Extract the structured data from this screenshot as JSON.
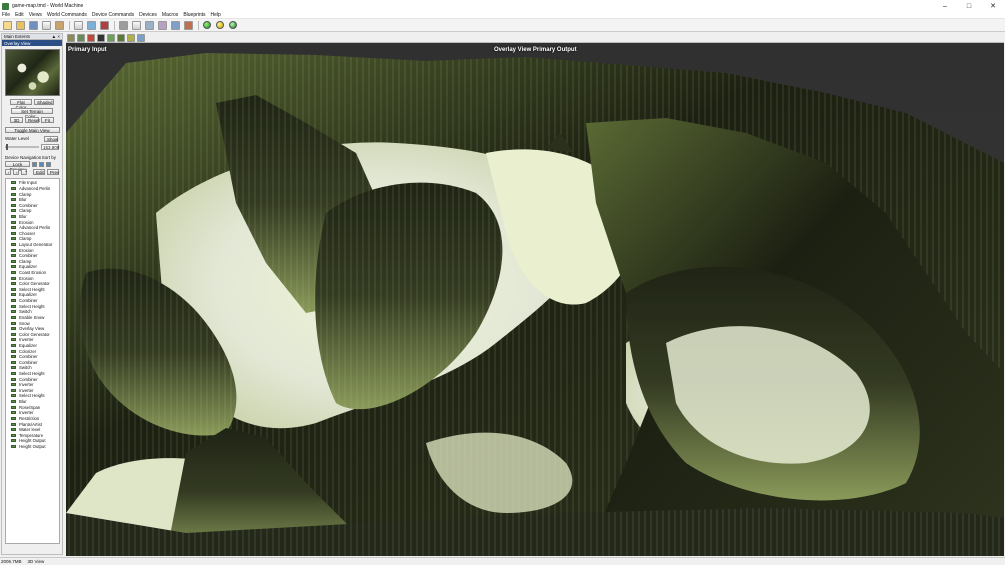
{
  "window": {
    "title": "game-map.tmd - World Machine"
  },
  "menu": [
    "File",
    "Edit",
    "Views",
    "World Commands",
    "Device Commands",
    "Devices",
    "Macros",
    "Blueprints",
    "Help"
  ],
  "toolbar_icons": [
    "new-file-icon",
    "open-folder-icon",
    "save-icon",
    "properties-icon",
    "world-settings-icon",
    "undo-icon",
    "chart-icon",
    "build-icon",
    "grid-icon",
    "layout-icon",
    "render-icon",
    "device-icon",
    "image-icon",
    "export-icon",
    "ball-green-icon",
    "ball-yellow-icon",
    "ball-globe-icon"
  ],
  "panel": {
    "title": "Main Extents",
    "overlay_view_label": "Overlay View",
    "flat_color": "Flat Color",
    "shaded": "Shaded",
    "set_terrain_color": "Set Terrain Color...",
    "btn_3d": "3D",
    "reset": "Reset",
    "fit": "Fit",
    "toggle_main_view": "Toggle Main View",
    "water_level": "Water Level",
    "show": "Show",
    "water_value": "153.809",
    "device_navigation": "Device Navigation",
    "sort_by": "Sort by",
    "lock_preview": "Lock Preview",
    "edit": "Edit",
    "prev": "Prev"
  },
  "devices": [
    "File Input",
    "Advanced Perlin",
    "Clamp",
    "Blur",
    "Combiner",
    "Clamp",
    "Blur",
    "Erosion",
    "Advanced Perlin",
    "Chooser",
    "Clamp",
    "Layout Generator",
    "Erosion",
    "Combiner",
    "Clamp",
    "Equalizer",
    "Coast Erosion",
    "Erosion",
    "Color Generator",
    "Select Height",
    "Equalizer",
    "Combiner",
    "Select Height",
    "Switch",
    "Enable Snow",
    "Snow",
    "Overlay View",
    "Color Generator",
    "Inverter",
    "Equalizer",
    "Colorizer",
    "Combiner",
    "Combiner",
    "Switch",
    "Select Height",
    "Combiner",
    "Inverter",
    "Inverter",
    "Select Height",
    "Blur",
    "Rose/Span",
    "Inverter",
    "Restriction",
    "Plants/Artist",
    "Water level",
    "Temperature",
    "Height Output",
    "Height Output"
  ],
  "view": {
    "label_left": "Primary Input",
    "label_center": "Overlay View Primary Output"
  },
  "view_toolbar_icons": [
    "camera-icon",
    "frame-icon",
    "terrain-icon",
    "cube-icon",
    "brush-icon",
    "texture-icon",
    "render-icon",
    "screenshot-icon"
  ],
  "status": {
    "memory": "2006.7MB",
    "mode": "3D View"
  },
  "colors": {
    "accent": "#2c4f86",
    "terrain_dark": "#1b2012",
    "terrain_green": "#c8d8a0",
    "snow": "#e8ebdc"
  }
}
